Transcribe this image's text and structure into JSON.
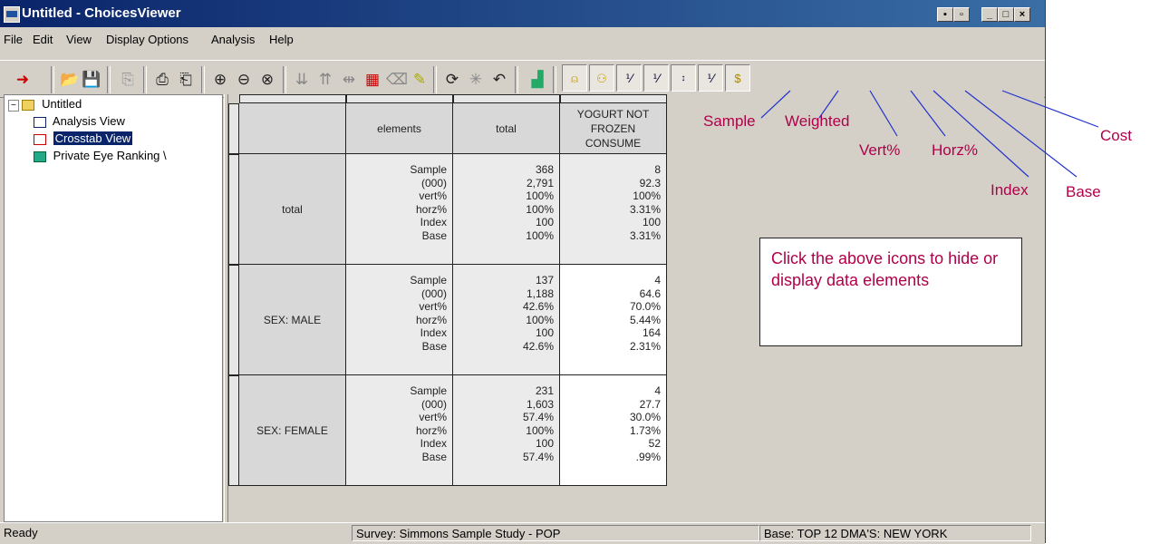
{
  "window": {
    "title": "Untitled - ChoicesViewer"
  },
  "menu": [
    "File",
    "Edit",
    "View",
    "Display Options",
    "Analysis",
    "Help"
  ],
  "tree": {
    "root": "Untitled",
    "items": [
      "Analysis View",
      "Crosstab View",
      "Private Eye Ranking \\"
    ]
  },
  "table": {
    "columns": [
      "elements",
      "total",
      "YOGURT NOT FROZEN CONSUME"
    ],
    "rows": [
      {
        "label": "total",
        "elements": [
          "Sample",
          "(000)",
          "vert%",
          "horz%",
          "Index",
          "Base"
        ],
        "total": [
          "368",
          "2,791",
          "100%",
          "100%",
          "100",
          "100%"
        ],
        "yogurt": [
          "8",
          "92.3",
          "100%",
          "3.31%",
          "100",
          "3.31%"
        ]
      },
      {
        "label": "SEX: MALE",
        "elements": [
          "Sample",
          "(000)",
          "vert%",
          "horz%",
          "Index",
          "Base"
        ],
        "total": [
          "137",
          "1,188",
          "42.6%",
          "100%",
          "100",
          "42.6%"
        ],
        "yogurt": [
          "4",
          "64.6",
          "70.0%",
          "5.44%",
          "164",
          "2.31%"
        ]
      },
      {
        "label": "SEX: FEMALE",
        "elements": [
          "Sample",
          "(000)",
          "vert%",
          "horz%",
          "Index",
          "Base"
        ],
        "total": [
          "231",
          "1,603",
          "57.4%",
          "100%",
          "100",
          "57.4%"
        ],
        "yogurt": [
          "4",
          "27.7",
          "30.0%",
          "1.73%",
          "52",
          ".99%"
        ]
      }
    ]
  },
  "status": {
    "left": "Ready",
    "survey": "Survey: Simmons Sample Study - POP",
    "base": "Base: TOP 12 DMA'S: NEW YORK"
  },
  "callouts": {
    "sample": "Sample",
    "weighted": "Weighted",
    "vert": "Vert%",
    "horz": "Horz%",
    "index": "Index",
    "base": "Base",
    "cost": "Cost"
  },
  "note": "Click the above icons to hide or display data elements",
  "colors": {
    "accent": "#b0004a",
    "title_bar": "#0a246a",
    "chrome": "#d4d0c8"
  }
}
